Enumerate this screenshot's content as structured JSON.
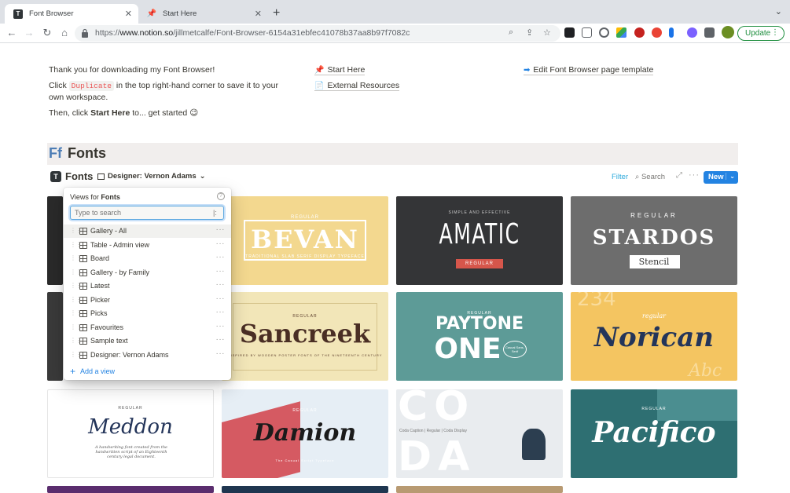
{
  "browser": {
    "tabs": [
      {
        "title": "Font Browser",
        "active": true
      },
      {
        "title": "Start Here",
        "active": false
      }
    ],
    "url_prefix": "https://",
    "url_host": "www.notion.so",
    "url_path": "/jillmetcalfe/Font-Browser-6154a31ebfec41078b37aa8b97f7082c",
    "update_label": "Update"
  },
  "intro": {
    "line1": "Thank you for downloading my Font Browser!",
    "line2_pre": "Click",
    "line2_code": "Duplicate",
    "line2_post": "in the top right-hand corner to save it to your",
    "line3": "own workspace.",
    "line4_pre": "Then, click",
    "line4_bold": "Start Here",
    "line4_post": "to... get started",
    "line4_emoji": "😉"
  },
  "links": {
    "start_here": "Start Here",
    "external": "External Resources",
    "edit_template": "Edit Font Browser page template"
  },
  "section": {
    "abbr": "Ff",
    "title": "Fonts"
  },
  "database": {
    "title": "Fonts",
    "view": "Designer: Vernon Adams",
    "filter": "Filter",
    "search": "Search",
    "new": "New"
  },
  "dropdown": {
    "head_pre": "Views for",
    "head_bold": "Fonts",
    "placeholder": "Type to search",
    "views": [
      "Gallery - All",
      "Table - Admin view",
      "Board",
      "Gallery - by Family",
      "Latest",
      "Picker",
      "Picks",
      "Favourites",
      "Sample text",
      "Designer: Vernon Adams"
    ],
    "add_view": "Add a view"
  },
  "cards": {
    "bevan": {
      "tag": "REGULAR",
      "name": "BEVAN",
      "sub": "TRADITIONAL SLAB SERIF DISPLAY TYPEFACE"
    },
    "amatic": {
      "tag": "SIMPLE AND EFFECTIVE",
      "name": "AMATIC",
      "sub": "REGULAR"
    },
    "stardos": {
      "tag": "REGULAR",
      "name": "STARDOS",
      "sub": "Stencil"
    },
    "sancreek": {
      "tag": "REGULAR",
      "name": "Sancreek",
      "sub": "INSPIRED BY WOODEN POSTER FONTS OF THE NINETEENTH CENTURY"
    },
    "paytone": {
      "tag": "REGULAR",
      "name1": "PAYTONE",
      "name2": "ONE",
      "sub": "Casual Sans-Serif"
    },
    "norican": {
      "tag": "regular",
      "name": "Norican",
      "digits": "234",
      "extra": "Abc"
    },
    "meddon": {
      "tag": "REGULAR",
      "name": "Meddon",
      "sub": "A handwriting font created from the handwritten script of an Eighteenth century legal document."
    },
    "damion": {
      "tag": "REGULAR",
      "name": "Damion",
      "sub": "The Casual Script Typeface"
    },
    "coda": {
      "name1": "CO",
      "name2": "DA",
      "sub": "Coda Caption | Regular | Coda Display"
    },
    "pacifico": {
      "tag": "REGULAR",
      "name": "Pacifico"
    }
  }
}
